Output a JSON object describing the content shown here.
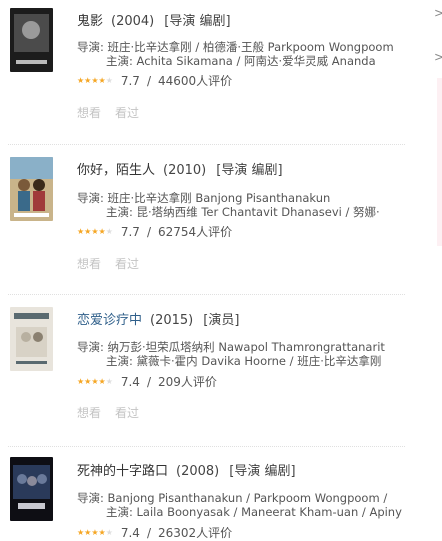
{
  "movies": [
    {
      "title": "鬼影",
      "year": "(2004)",
      "role": "[导演 编剧]",
      "director": "导演: 班庄·比辛达拿刚 / 柏德潘·王般 Parkpoom Wongpoom",
      "cast": "主演: Achita Sikamana / 阿南达·爱华灵威 Ananda",
      "stars": 4,
      "score": "7.7",
      "votes": "44600人评价",
      "want": "想看",
      "seen": "看过",
      "poster_colors": [
        "#1c1c1c",
        "#4b4b4b",
        "#9a9a9a"
      ]
    },
    {
      "title": "你好，陌生人",
      "year": "(2010)",
      "role": "[导演 编剧]",
      "director": "导演: 班庄·比辛达拿刚 Banjong Pisanthanakun",
      "cast": "主演: 昆·塔纳西维 Ter Chantavit Dhanasevi / 努娜·",
      "stars": 4,
      "score": "7.7",
      "votes": "62754人评价",
      "want": "想看",
      "seen": "看过",
      "poster_colors": [
        "#7a5a3a",
        "#c9b48a",
        "#3a6a8a"
      ]
    },
    {
      "title": "恋爱诊疗中",
      "year": "(2015)",
      "role": "[演员]",
      "director": "导演: 纳万彭·坦荣瓜塔纳利 Nawapol Thamrongrattanarit",
      "cast": "主演: 黛薇卡·霍内 Davika Hoorne / 班庄·比辛达拿刚",
      "stars": 4,
      "score": "7.4",
      "votes": "209人评价",
      "want": "想看",
      "seen": "看过",
      "poster_colors": [
        "#e8e4dc",
        "#b8b0a0",
        "#5a6a70"
      ]
    },
    {
      "title": "死神的十字路口",
      "year": "(2008)",
      "role": "[导演 编剧]",
      "director": "导演: Banjong Pisanthanakun / Parkpoom Wongpoom /",
      "cast": "主演: Laila Boonyasak / Maneerat Kham-uan / Apinya",
      "stars": 4,
      "score": "7.4",
      "votes": "26302人评价",
      "want": "",
      "seen": "",
      "poster_colors": [
        "#0e0e14",
        "#2a3a5a",
        "#6a7a9a"
      ]
    }
  ],
  "separator": "/",
  "sidebar_arrow": ">"
}
